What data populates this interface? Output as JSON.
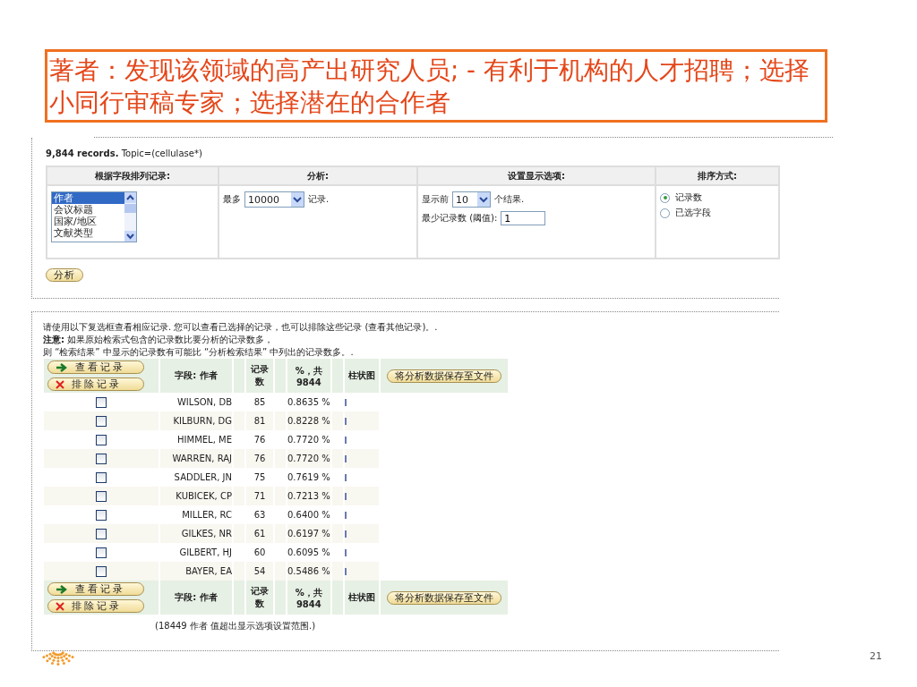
{
  "title": "著者：发现该领域的高产出研究人员; - 有利于机构的人才招聘；选择小同行审稿专家；选择潜在的合作者",
  "records_summary": {
    "count": "9,844 records.",
    "query": "Topic=(cellulase*)"
  },
  "options_table": {
    "columns": [
      "根据字段排列记录:",
      "分析:",
      "设置显示选项:",
      "排序方式:"
    ],
    "field_list": [
      {
        "label": "作者",
        "selected": true
      },
      {
        "label": "会议标题",
        "selected": false
      },
      {
        "label": "国家/地区",
        "selected": false
      },
      {
        "label": "文献类型",
        "selected": false
      }
    ],
    "analyze": {
      "prefix": "最多",
      "value": "10000",
      "suffix": "记录."
    },
    "display": {
      "prefix": "显示前",
      "value": "10",
      "suffix": "个结果.",
      "threshold_label": "最少记录数 (阈值):",
      "threshold_value": "1"
    },
    "sort": [
      {
        "label": "记录数",
        "selected": true
      },
      {
        "label": "已选字段",
        "selected": false
      }
    ]
  },
  "analyze_button": "分析",
  "notes": [
    "请使用以下复选框查看相应记录. 您可以查看已选择的记录，也可以排除这些记录 (查看其他记录)。.",
    "**注意:** 如果原始检索式包含的记录数比要分析的记录数多，",
    "则 “检索结果” 中显示的记录数有可能比 “分析检索结果” 中列出的记录数多。."
  ],
  "results": {
    "header_bar": {
      "view_button": "查看记录",
      "exclude_button": "排除记录",
      "columns": [
        "字段: 作者",
        "记录数",
        "%，共 9844",
        "柱状图"
      ],
      "save_button": "将分析数据保存至文件"
    },
    "rows": [
      {
        "name": "WILSON, DB",
        "count": "85",
        "percent": "0.8635 %",
        "checked": false
      },
      {
        "name": "KILBURN, DG",
        "count": "81",
        "percent": "0.8228 %",
        "checked": false
      },
      {
        "name": "HIMMEL, ME",
        "count": "76",
        "percent": "0.7720 %",
        "checked": false
      },
      {
        "name": "WARREN, RAJ",
        "count": "76",
        "percent": "0.7720 %",
        "checked": false
      },
      {
        "name": "SADDLER, JN",
        "count": "75",
        "percent": "0.7619 %",
        "checked": false
      },
      {
        "name": "KUBICEK, CP",
        "count": "71",
        "percent": "0.7213 %",
        "checked": false
      },
      {
        "name": "MILLER, RC",
        "count": "63",
        "percent": "0.6400 %",
        "checked": false
      },
      {
        "name": "GILKES, NR",
        "count": "61",
        "percent": "0.6197 %",
        "checked": false
      },
      {
        "name": "GILBERT, HJ",
        "count": "60",
        "percent": "0.6095 %",
        "checked": false
      },
      {
        "name": "BAYER, EA",
        "count": "54",
        "percent": "0.5486 %",
        "checked": false
      }
    ],
    "footer_bar": {
      "view_button": "查看记录",
      "exclude_button": "排除记录",
      "columns": [
        "字段: 作者",
        "记录数",
        "%，共 9844",
        "柱状图"
      ],
      "save_button": "将分析数据保存至文件"
    },
    "footnote": "(18449 作者  值超出显示选项设置范围.)"
  },
  "page_number": "21"
}
